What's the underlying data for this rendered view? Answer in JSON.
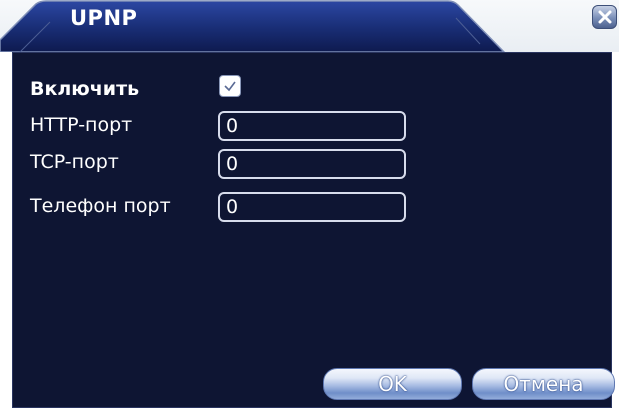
{
  "dialog": {
    "title": "UPNP",
    "close_icon": "close-x-icon"
  },
  "fields": {
    "enable": {
      "label": "Включить",
      "checked": true
    },
    "http_port": {
      "label": "HTTP-порт",
      "value": "0"
    },
    "tcp_port": {
      "label": "TCP-порт",
      "value": "0"
    },
    "phone_port": {
      "label": "Телефон порт",
      "value": "0"
    }
  },
  "buttons": {
    "ok_label": "OK",
    "cancel_label": "Отмена"
  },
  "colors": {
    "panel_bg": "#0e1533",
    "title_tab": "#1a2f78",
    "button_accent": "#6f8ec9"
  }
}
